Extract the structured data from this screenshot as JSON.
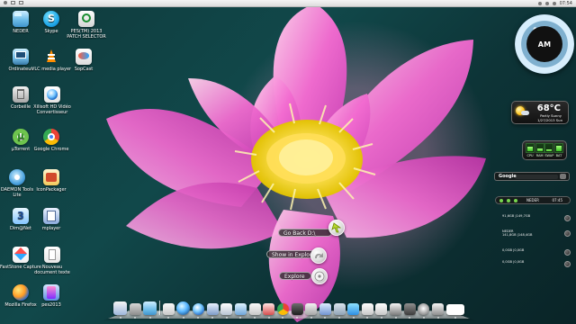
{
  "desktop_icons": [
    {
      "label": "NEDER",
      "icon": "folder-icon"
    },
    {
      "label": "Skype",
      "icon": "skype-icon"
    },
    {
      "label": "PES(TM) 2013 PATCH SELECTOR",
      "icon": "pes-patch-selector-icon"
    },
    {
      "label": "Ordinateur",
      "icon": "computer-icon"
    },
    {
      "label": "VLC media player",
      "icon": "vlc-icon"
    },
    {
      "label": "SopCast",
      "icon": "sopcast-icon"
    },
    {
      "label": "Corbeille",
      "icon": "recycle-bin-icon"
    },
    {
      "label": "Xilisoft HD Vidéo Convertisseur",
      "icon": "xilisoft-icon"
    },
    {
      "label": "µTorrent",
      "icon": "utorrent-icon"
    },
    {
      "label": "Google Chrome",
      "icon": "chrome-icon"
    },
    {
      "label": "DAEMON Tools Lite",
      "icon": "daemon-tools-icon"
    },
    {
      "label": "IconPackager",
      "icon": "iconpackager-icon"
    },
    {
      "label": "Dim@Net",
      "icon": "dimnet-icon"
    },
    {
      "label": "mplayer",
      "icon": "mplayer-icon"
    },
    {
      "label": "FastStone Capture",
      "icon": "faststone-icon"
    },
    {
      "label": "Nouveau document texte",
      "icon": "text-document-icon"
    },
    {
      "label": "Mozilla Firefox",
      "icon": "firefox-icon"
    },
    {
      "label": "pes2013",
      "icon": "pes2013-icon"
    }
  ],
  "context_menu": {
    "items": [
      "Go Back D:\\",
      "Show in Explorer",
      "Explore"
    ]
  },
  "clock": {
    "label": "AM"
  },
  "weather": {
    "temperature": "68°C",
    "description": "Partly Sunny",
    "date": "1/27/2013 Sun"
  },
  "system_meters": {
    "labels": [
      "CPU",
      "RAM",
      "SWAP",
      "BAT"
    ],
    "levels": [
      0.55,
      0.35,
      0.25,
      0.7
    ]
  },
  "google_widget": {
    "label": "Google"
  },
  "status_bar": {
    "name": "NEDER",
    "time": "07:45"
  },
  "drives": [
    {
      "line1": "91,6GB   |149,7GB",
      "line2": ""
    },
    {
      "line1": "NEDER",
      "line2": "141,8GB   |148,4GB"
    },
    {
      "line1": "0,0GB   |0,0GB",
      "line2": ""
    },
    {
      "line1": "0,0GB   |0,0GB",
      "line2": ""
    }
  ],
  "top_bar": {
    "time": "07:54"
  },
  "dock_items": [
    "finder-icon",
    "settings-icon",
    "folder-icon",
    "file-icon",
    "globe-icon",
    "safari-icon",
    "mail-icon",
    "mail-icon",
    "finder-icon",
    "calendar-icon",
    "pdf-icon",
    "chrome-icon",
    "player-icon",
    "trash-icon",
    "mail-icon",
    "disk-icon",
    "app-store-icon",
    "music-icon",
    "music-icon",
    "video-icon",
    "tools-icon",
    "power-icon",
    "trash-icon",
    "blank-icon"
  ]
}
